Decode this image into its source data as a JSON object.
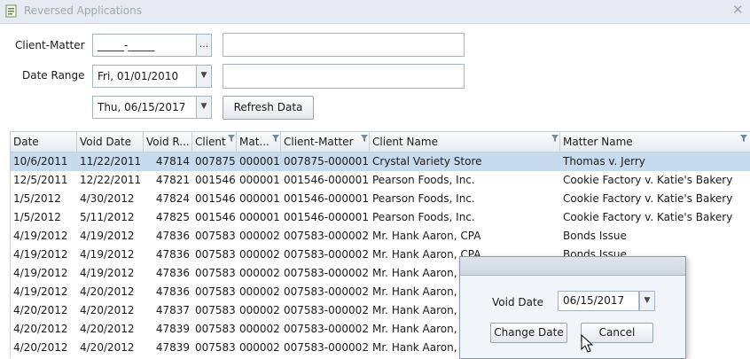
{
  "window": {
    "title": "Reversed Applications",
    "close_symbol": "✕"
  },
  "filters": {
    "client_matter_label": "Client-Matter",
    "client_matter_value": "_____-_____",
    "browse_label": "...",
    "client_matter_desc": "",
    "date_range_label": "Date Range",
    "date_from": "Fri, 01/01/2010",
    "date_from_desc": "",
    "date_to": "Thu, 06/15/2017",
    "dropdown_symbol": "▼",
    "refresh_label": "Refresh Data"
  },
  "grid": {
    "columns": [
      "Date",
      "Void Date",
      "Void R...",
      "Client",
      "Mat...",
      "Client-Matter",
      "Client Name",
      "Matter Name"
    ],
    "rows": [
      [
        "10/6/2011",
        "11/22/2011",
        "47814",
        "007875",
        "000001",
        "007875-000001",
        "Crystal Variety Store",
        "Thomas v. Jerry"
      ],
      [
        "12/5/2011",
        "12/22/2011",
        "47821",
        "001546",
        "000001",
        "001546-000001",
        "Pearson Foods, Inc.",
        "Cookie Factory v. Katie's Bakery"
      ],
      [
        "1/5/2012",
        "4/30/2012",
        "47824",
        "001546",
        "000001",
        "001546-000001",
        "Pearson Foods, Inc.",
        "Cookie Factory v. Katie's Bakery"
      ],
      [
        "1/5/2012",
        "5/11/2012",
        "47825",
        "001546",
        "000001",
        "001546-000001",
        "Pearson Foods, Inc.",
        "Cookie Factory v. Katie's Bakery"
      ],
      [
        "4/19/2012",
        "4/19/2012",
        "47836",
        "007583",
        "000002",
        "007583-000002",
        "Mr. Hank Aaron, CPA",
        "Bonds Issue"
      ],
      [
        "4/19/2012",
        "4/19/2012",
        "47836",
        "007583",
        "000002",
        "007583-000002",
        "Mr. Hank Aaron, CPA",
        "Bonds Issue"
      ],
      [
        "4/19/2012",
        "4/19/2012",
        "47836",
        "007583",
        "000002",
        "007583-000002",
        "Mr. Hank Aaron, C",
        ""
      ],
      [
        "4/19/2012",
        "4/20/2012",
        "47836",
        "007583",
        "000002",
        "007583-000002",
        "Mr. Hank Aaron, C",
        ""
      ],
      [
        "4/20/2012",
        "4/20/2012",
        "47837",
        "007583",
        "000002",
        "007583-000002",
        "Mr. Hank Aaron, C",
        ""
      ],
      [
        "4/20/2012",
        "4/20/2012",
        "47839",
        "007583",
        "000002",
        "007583-000002",
        "Mr. Hank Aaron, C",
        ""
      ],
      [
        "4/20/2012",
        "4/20/2012",
        "47839",
        "007583",
        "000002",
        "007583-000002",
        "Mr. Hank Aaron, C",
        ""
      ]
    ]
  },
  "void_dialog": {
    "void_date_label": "Void Date",
    "void_date_value": "06/15/2017",
    "change_label": "Change Date",
    "cancel_label": "Cancel"
  },
  "colors": {
    "selected_row": "#c8dbee",
    "header_bg": "#e7ebf0",
    "title_text": "#9ca7b3"
  }
}
